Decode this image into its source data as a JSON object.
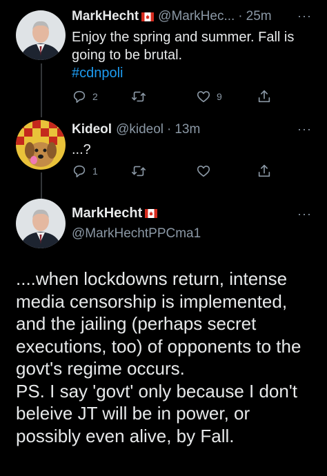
{
  "tweets": [
    {
      "name": "MarkHecht",
      "handle": "@MarkHec...",
      "time": "25m",
      "text": "Enjoy the spring and summer. Fall is going to be brutal.",
      "hashtag": "#cdnpoli",
      "replies": "2",
      "retweets": "",
      "likes": "9"
    },
    {
      "name": "Kideol",
      "handle": "@kideol",
      "time": "13m",
      "text": "...?",
      "replies": "1",
      "retweets": "",
      "likes": ""
    }
  ],
  "main_tweet": {
    "name": "MarkHecht",
    "handle": "@MarkHechtPPCma1",
    "paragraph1": "....when lockdowns return, intense media censorship is implemented, and the jailing (perhaps secret executions, too) of opponents to the govt's regime occurs.",
    "paragraph2": "PS. I say 'govt' only because I don't beleive JT will be in power, or possibly even alive, by Fall."
  },
  "more_glyph": "···",
  "colors": {
    "background": "#000000",
    "text": "#e7e9ea",
    "secondary": "#8b98a5",
    "link": "#1d9bf0",
    "flag_red": "#d52b1e"
  },
  "icons": [
    "reply-icon",
    "retweet-icon",
    "like-icon",
    "share-icon",
    "canada-flag-icon",
    "more-options-icon"
  ]
}
